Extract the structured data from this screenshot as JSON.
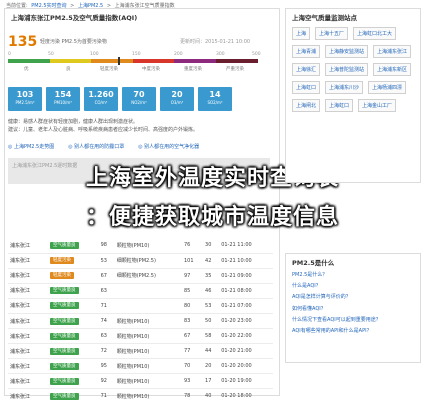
{
  "breadcrumb": [
    "当前位置:",
    "PM2.5实时查询",
    ">",
    "上海PM2.5",
    ">",
    "上海浦东张江空气质量指数"
  ],
  "main": {
    "title": "上海浦东张江PM2.5及空气质量指数(AQI)",
    "aqi_value": "135",
    "aqi_desc": "轻度污染 PM2.5为首要污染物",
    "update_time": "更新时间：2015-01-21 10:00",
    "scale_ticks": [
      "0",
      "50",
      "100",
      "150",
      "200",
      "300",
      "500"
    ],
    "scale_labels": [
      "优",
      "良",
      "轻度污染",
      "中度污染",
      "重度污染",
      "严重污染"
    ],
    "pollutants": [
      {
        "value": "103",
        "unit": "PM2.5/m³"
      },
      {
        "value": "154",
        "unit": "PM10/m³"
      },
      {
        "value": "1.260",
        "unit": "CO/m³"
      },
      {
        "value": "70",
        "unit": "NO2/m³"
      },
      {
        "value": "20",
        "unit": "O3/m³"
      },
      {
        "value": "14",
        "unit": "SO2/m³"
      }
    ],
    "advice_1": "健康：易感人群症状有轻度加剧，健康人群出现刺激症状。",
    "advice_2": "建议：儿童、老年人及心脏病、呼吸系统疾病患者应减少长时间、高强度的户外锻炼。",
    "tabs": [
      "◎ 上海PM2.5走势图",
      "◎ 别人都在用的防霾口罩",
      "◎ 别人都在用的空气净化器"
    ],
    "table_header": "上海浦东张江PM2.5逐时数据",
    "rows": [
      {
        "site": "浦东张江",
        "level": "空气质量良",
        "aqi": "98",
        "pollutant": "颗粒物(PM10)",
        "pm": "76",
        "o3": "30",
        "time": "01-21 11:00"
      },
      {
        "site": "浦东张江",
        "level": "轻度污染",
        "aqi": "53",
        "pollutant": "细颗粒物(PM2.5)",
        "pm": "101",
        "o3": "42",
        "time": "01-21 10:00"
      },
      {
        "site": "浦东张江",
        "level": "轻度污染",
        "aqi": "67",
        "pollutant": "细颗粒物(PM2.5)",
        "pm": "97",
        "o3": "35",
        "time": "01-21 09:00"
      },
      {
        "site": "浦东张江",
        "level": "空气质量良",
        "aqi": "63",
        "pollutant": "",
        "pm": "85",
        "o3": "46",
        "time": "01-21 08:00"
      },
      {
        "site": "浦东张江",
        "level": "空气质量良",
        "aqi": "71",
        "pollutant": "",
        "pm": "80",
        "o3": "53",
        "time": "01-21 07:00"
      },
      {
        "site": "浦东张江",
        "level": "空气质量良",
        "aqi": "74",
        "pollutant": "颗粒物(PM10)",
        "pm": "83",
        "o3": "50",
        "time": "01-20 23:00"
      },
      {
        "site": "浦东张江",
        "level": "空气质量良",
        "aqi": "63",
        "pollutant": "颗粒物(PM10)",
        "pm": "67",
        "o3": "58",
        "time": "01-20 22:00"
      },
      {
        "site": "浦东张江",
        "level": "空气质量良",
        "aqi": "72",
        "pollutant": "颗粒物(PM10)",
        "pm": "77",
        "o3": "44",
        "time": "01-20 21:00"
      },
      {
        "site": "浦东张江",
        "level": "空气质量良",
        "aqi": "95",
        "pollutant": "颗粒物(PM10)",
        "pm": "70",
        "o3": "20",
        "time": "01-20 20:00"
      },
      {
        "site": "浦东张江",
        "level": "空气质量良",
        "aqi": "92",
        "pollutant": "颗粒物(PM10)",
        "pm": "93",
        "o3": "17",
        "time": "01-20 19:00"
      },
      {
        "site": "浦东张江",
        "level": "空气质量良",
        "aqi": "71",
        "pollutant": "颗粒物(PM10)",
        "pm": "78",
        "o3": "40",
        "time": "01-20 18:00"
      }
    ]
  },
  "overlay": {
    "line1": "上海室外温度实时查询表",
    "line2": "：便捷获取城市温度信息"
  },
  "sidebar": {
    "stations_title": "上海空气质量监测站点",
    "stations": [
      "上海",
      "上海十五厂",
      "上海虹口北工大",
      "上海青浦",
      "上海静安监测站",
      "上海浦东张江",
      "上海徐汇",
      "上海普陀监测站",
      "上海浦东新区",
      "上海虹口",
      "上海浦东川沙",
      "上海杨浦四漂",
      "上海闸北",
      "上海虹口",
      "上海金山工厂"
    ],
    "faq_title": "PM2.5是什么",
    "faq": [
      "PM2.5是什么？",
      "什么是AQI？",
      "AQI是怎样计算与评价的？",
      "如何看懂AQI？",
      "什么情况下查看AQI可以起到重要用途？",
      "AQI有哪些常用的API和什么是API？"
    ]
  },
  "colors": {
    "aqi_scale": [
      "#3fa34d",
      "#e0c91e",
      "#e08a1e",
      "#d9362b",
      "#8e2a7e",
      "#6b1f2e"
    ],
    "pollutant_box": "#3a9ad0",
    "link": "#2266bb"
  }
}
